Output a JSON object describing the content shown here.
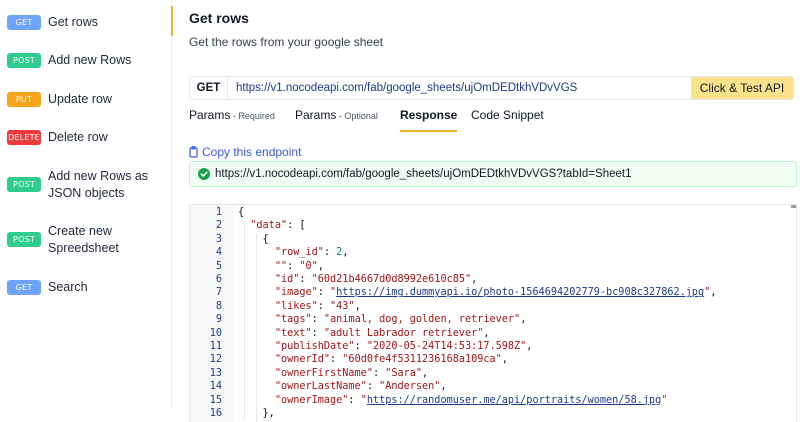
{
  "sidebar": {
    "items": [
      {
        "method": "GET",
        "color": "#6fa3f7",
        "label": "Get rows"
      },
      {
        "method": "POST",
        "color": "#2ecc8f",
        "label": "Add new Rows"
      },
      {
        "method": "PUT",
        "color": "#f7a21b",
        "label": "Update row"
      },
      {
        "method": "DELETE",
        "color": "#ee3a3a",
        "label": "Delete row"
      },
      {
        "method": "POST",
        "color": "#2ecc8f",
        "label": "Add new Rows as JSON objects"
      },
      {
        "method": "POST",
        "color": "#2ecc8f",
        "label": "Create new Spreedsheet"
      },
      {
        "method": "GET",
        "color": "#6fa3f7",
        "label": "Search"
      }
    ]
  },
  "main": {
    "title": "Get rows",
    "subtitle": "Get the rows from your google sheet",
    "request": {
      "method": "GET",
      "url": "https://v1.nocodeapi.com/fab/google_sheets/ujOmDEDtkhVDvVGS",
      "test_label": "Click & Test API"
    },
    "tabs": [
      {
        "label": "Params",
        "sub": " - Required"
      },
      {
        "label": "Params",
        "sub": " - Optional"
      },
      {
        "label": "Response",
        "sub": ""
      },
      {
        "label": "Code Snippet",
        "sub": ""
      }
    ],
    "copy_label": "Copy this endpoint",
    "endpoint": "https://v1.nocodeapi.com/fab/google_sheets/ujOmDEDtkhVDvVGS?tabId=Sheet1"
  },
  "code": {
    "lines": [
      {
        "n": "1",
        "t": [
          [
            "p",
            "{"
          ]
        ]
      },
      {
        "n": "2",
        "t": [
          [
            "p",
            "  "
          ],
          [
            "k",
            "\"data\""
          ],
          [
            "p",
            ": ["
          ]
        ]
      },
      {
        "n": "3",
        "t": [
          [
            "p",
            "    {"
          ]
        ]
      },
      {
        "n": "4",
        "t": [
          [
            "p",
            "      "
          ],
          [
            "k",
            "\"row_id\""
          ],
          [
            "p",
            ": "
          ],
          [
            "n",
            "2"
          ],
          [
            "p",
            ","
          ]
        ]
      },
      {
        "n": "5",
        "t": [
          [
            "p",
            "      "
          ],
          [
            "k",
            "\"\""
          ],
          [
            "p",
            ": "
          ],
          [
            "s",
            "\"0\""
          ],
          [
            "p",
            ","
          ]
        ]
      },
      {
        "n": "6",
        "t": [
          [
            "p",
            "      "
          ],
          [
            "k",
            "\"id\""
          ],
          [
            "p",
            ": "
          ],
          [
            "s",
            "\"60d21b4667d0d8992e610c85\""
          ],
          [
            "p",
            ","
          ]
        ]
      },
      {
        "n": "7",
        "t": [
          [
            "p",
            "      "
          ],
          [
            "k",
            "\"image\""
          ],
          [
            "p",
            ": "
          ],
          [
            "s",
            "\""
          ],
          [
            "u",
            "https://img.dummyapi.io/photo-1564694202779-bc908c327862.jpg"
          ],
          [
            "s",
            "\""
          ],
          [
            "p",
            ","
          ]
        ]
      },
      {
        "n": "8",
        "t": [
          [
            "p",
            "      "
          ],
          [
            "k",
            "\"likes\""
          ],
          [
            "p",
            ": "
          ],
          [
            "s",
            "\"43\""
          ],
          [
            "p",
            ","
          ]
        ]
      },
      {
        "n": "9",
        "t": [
          [
            "p",
            "      "
          ],
          [
            "k",
            "\"tags\""
          ],
          [
            "p",
            ": "
          ],
          [
            "s",
            "\"animal, dog, golden, retriever\""
          ],
          [
            "p",
            ","
          ]
        ]
      },
      {
        "n": "10",
        "t": [
          [
            "p",
            "      "
          ],
          [
            "k",
            "\"text\""
          ],
          [
            "p",
            ": "
          ],
          [
            "s",
            "\"adult Labrador retriever\""
          ],
          [
            "p",
            ","
          ]
        ]
      },
      {
        "n": "11",
        "t": [
          [
            "p",
            "      "
          ],
          [
            "k",
            "\"publishDate\""
          ],
          [
            "p",
            ": "
          ],
          [
            "s",
            "\"2020-05-24T14:53:17.598Z\""
          ],
          [
            "p",
            ","
          ]
        ]
      },
      {
        "n": "12",
        "t": [
          [
            "p",
            "      "
          ],
          [
            "k",
            "\"ownerId\""
          ],
          [
            "p",
            ": "
          ],
          [
            "s",
            "\"60d0fe4f5311236168a109ca\""
          ],
          [
            "p",
            ","
          ]
        ]
      },
      {
        "n": "13",
        "t": [
          [
            "p",
            "      "
          ],
          [
            "k",
            "\"ownerFirstName\""
          ],
          [
            "p",
            ": "
          ],
          [
            "s",
            "\"Sara\""
          ],
          [
            "p",
            ","
          ]
        ]
      },
      {
        "n": "14",
        "t": [
          [
            "p",
            "      "
          ],
          [
            "k",
            "\"ownerLastName\""
          ],
          [
            "p",
            ": "
          ],
          [
            "s",
            "\"Andersen\""
          ],
          [
            "p",
            ","
          ]
        ]
      },
      {
        "n": "15",
        "t": [
          [
            "p",
            "      "
          ],
          [
            "k",
            "\"ownerImage\""
          ],
          [
            "p",
            ": "
          ],
          [
            "s",
            "\""
          ],
          [
            "u",
            "https://randomuser.me/api/portraits/women/58.jpg"
          ],
          [
            "s",
            "\""
          ]
        ]
      },
      {
        "n": "16",
        "t": [
          [
            "p",
            "    },"
          ]
        ]
      }
    ]
  }
}
